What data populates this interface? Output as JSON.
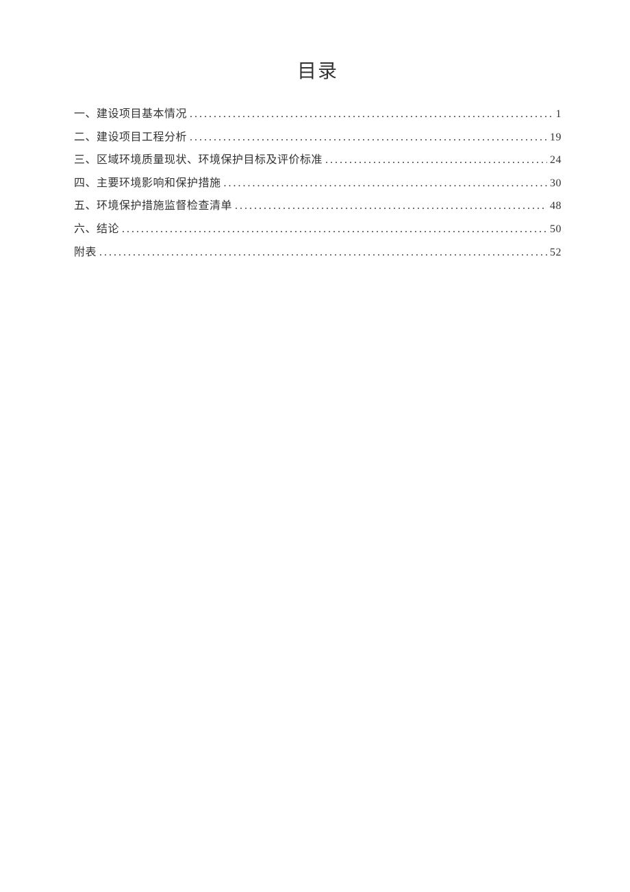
{
  "title": "目录",
  "toc": [
    {
      "label": "一、建设项目基本情况",
      "page": "1"
    },
    {
      "label": "二、建设项目工程分析",
      "page": "19"
    },
    {
      "label": "三、区域环境质量现状、环境保护目标及评价标准",
      "page": "24"
    },
    {
      "label": "四、主要环境影响和保护措施",
      "page": "30"
    },
    {
      "label": "五、环境保护措施监督检查清单",
      "page": "48"
    },
    {
      "label": "六、结论",
      "page": "50"
    },
    {
      "label": "附表",
      "page": "52"
    }
  ]
}
